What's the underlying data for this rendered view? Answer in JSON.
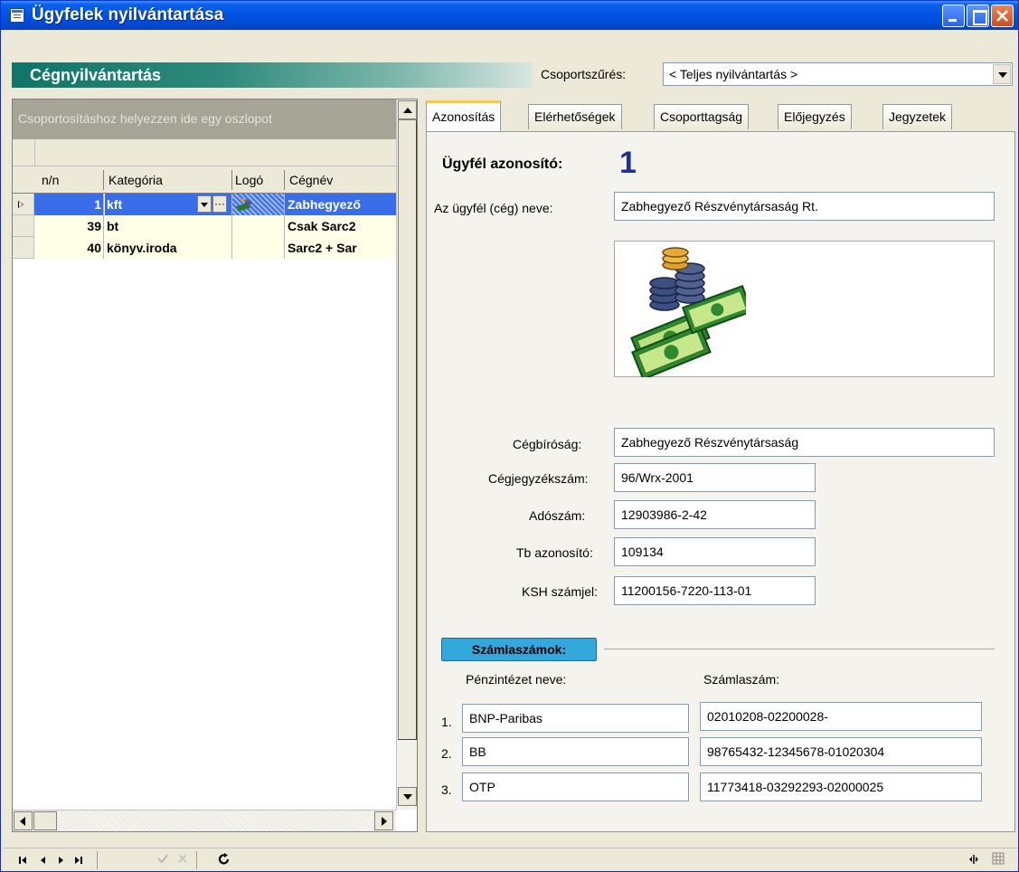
{
  "window": {
    "title": "Ügyfelek nyilvántartása"
  },
  "header": {
    "title": "Cégnyilvántartás",
    "filter_label": "Csoportszűrés:",
    "filter_value": "< Teljes nyilvántartás >"
  },
  "grid": {
    "group_hint": "Csoportosításhoz helyezzen ide egy oszlopot",
    "columns": [
      "n/n",
      "Kategória",
      "Logó",
      "Cégnév"
    ],
    "rows": [
      {
        "nn": "1",
        "kategoria": "kft",
        "cegnev": "Zabhegyező",
        "selected": true
      },
      {
        "nn": "39",
        "kategoria": "bt",
        "cegnev": "Csak Sarc2"
      },
      {
        "nn": "40",
        "kategoria": "könyv.iroda",
        "cegnev": "Sarc2 + Sar"
      }
    ],
    "ellipsis": "···"
  },
  "tabs": [
    "Azonosítás",
    "Elérhetőségek",
    "Csoporttagság",
    "Előjegyzés",
    "Jegyzetek"
  ],
  "form": {
    "id_label": "Ügyfél azonosító:",
    "id_value": "1",
    "name_label": "Az ügyfél (cég) neve:",
    "name_value": "Zabhegyező Részvénytársaság Rt.",
    "cegbirosag_label": "Cégbíróság:",
    "cegbirosag_value": "Zabhegyező Részvénytársaság",
    "cegjegyzekszam_label": "Cégjegyzékszám:",
    "cegjegyzekszam_value": "96/Wrx-2001",
    "adoszam_label": "Adószám:",
    "adoszam_value": "12903986-2-42",
    "tb_label": "Tb azonosító:",
    "tb_value": "109134",
    "ksh_label": "KSH számjel:",
    "ksh_value": "11200156-7220-113-01"
  },
  "accounts": {
    "section_title": "Számlaszámok:",
    "bank_col_label": "Pénzintézet neve:",
    "account_col_label": "Számlaszám:",
    "rows": [
      {
        "num": "1.",
        "bank": "BNP-Paribas",
        "account": "02010208-02200028-"
      },
      {
        "num": "2.",
        "bank": "BB",
        "account": "98765432-12345678-01020304"
      },
      {
        "num": "3.",
        "bank": "OTP",
        "account": "11773418-03292293-02000025"
      }
    ]
  },
  "colors": {
    "title_bar": "#0054e3",
    "header_teal": "#0f7568",
    "selection": "#3a6ee8",
    "id_blue": "#1f2f96",
    "section_blue": "#34a7dc"
  }
}
